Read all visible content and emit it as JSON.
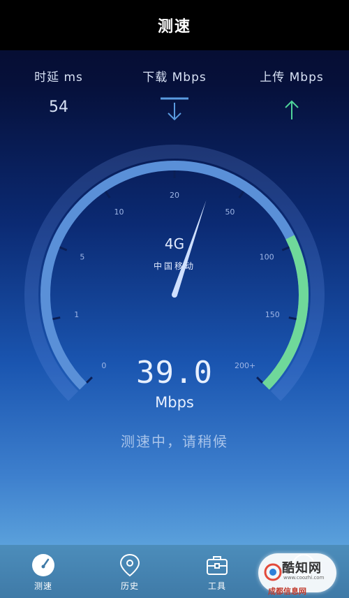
{
  "header": {
    "title": "测速"
  },
  "stats": {
    "latency": {
      "label": "时延 ms",
      "value": "54"
    },
    "download": {
      "label": "下载 Mbps",
      "icon": "download-arrow-icon",
      "color": "#5a9be0"
    },
    "upload": {
      "label": "上传 Mbps",
      "icon": "upload-arrow-icon",
      "color": "#4fd39a"
    }
  },
  "gauge": {
    "ticks": [
      "0",
      "1",
      "5",
      "10",
      "20",
      "50",
      "100",
      "150",
      "200+"
    ],
    "colors": {
      "track": "#5a90d8",
      "upload_segment": "#6fd89a",
      "needle": "#cfe0ff"
    },
    "network": "4G",
    "carrier": "中国移动",
    "speed": "39.0",
    "unit": "Mbps",
    "status": "测速中，请稍候"
  },
  "nav": {
    "items": [
      {
        "label": "测速",
        "icon": "speedometer-icon",
        "active": true
      },
      {
        "label": "历史",
        "icon": "location-pin-icon"
      },
      {
        "label": "工具",
        "icon": "toolbox-icon"
      },
      {
        "label": "",
        "icon": "more-icon"
      }
    ]
  },
  "watermark": {
    "title": "酷知网",
    "url": "www.coozhi.com",
    "footer": "成都信息网"
  }
}
